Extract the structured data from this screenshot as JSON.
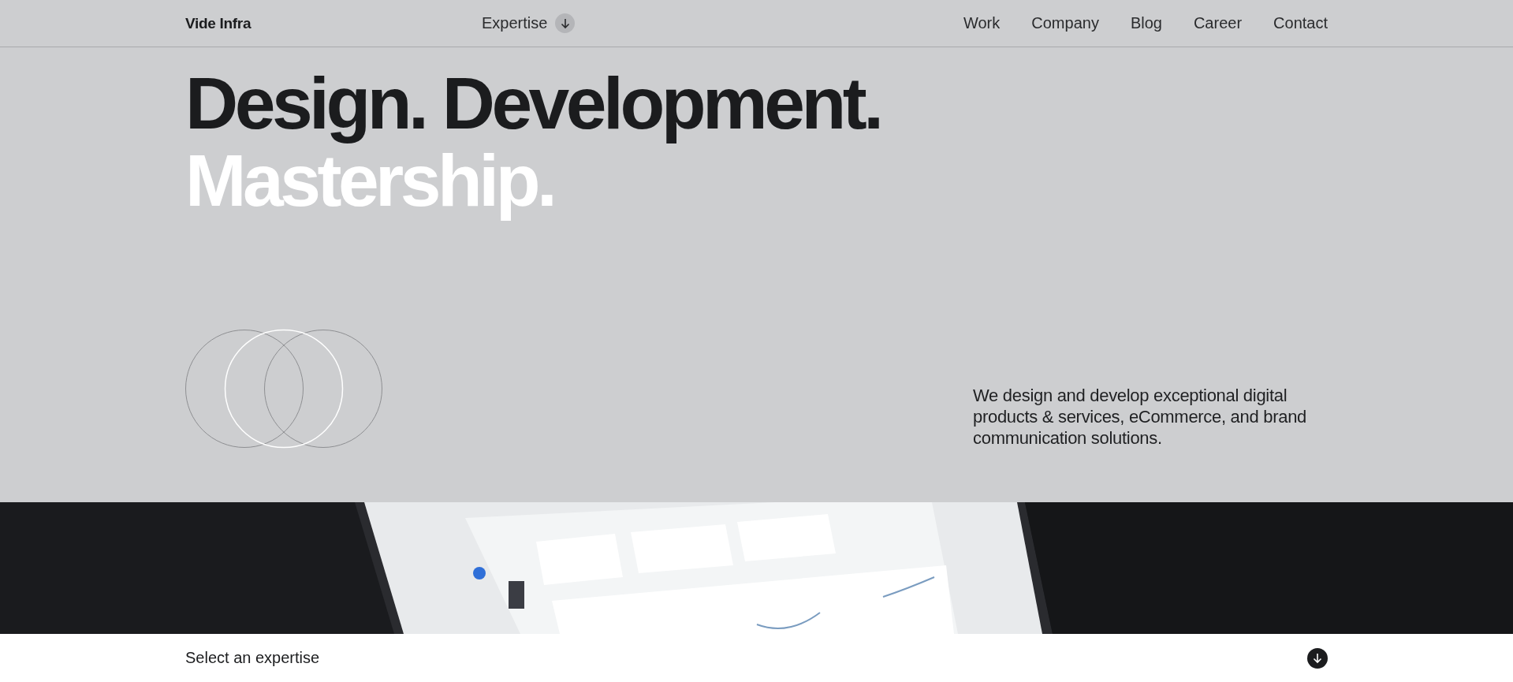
{
  "nav": {
    "logo": "Vide Infra",
    "expertise": "Expertise",
    "links": [
      "Work",
      "Company",
      "Blog",
      "Career",
      "Contact"
    ]
  },
  "hero": {
    "line_1": "Design. Development.",
    "line_2": "Mastership.",
    "description": "We design and develop exceptional digital products & services, eCommerce, and brand communication solutions."
  },
  "footer_bar": {
    "label": "Select an expertise"
  }
}
